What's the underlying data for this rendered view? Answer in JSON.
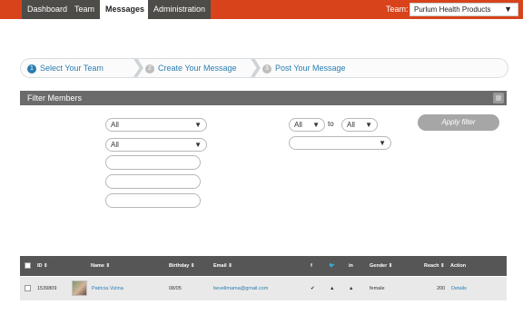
{
  "nav": {
    "tabs": [
      "Dashboard",
      "Team",
      "Messages",
      "Administration"
    ],
    "active_tab": "Messages",
    "team_label": "Team:",
    "team_value": "Purlum Health Products"
  },
  "steps": [
    {
      "num": "1",
      "label": "Select Your Team"
    },
    {
      "num": "2",
      "label": "Create Your Message"
    },
    {
      "num": "3",
      "label": "Post Your Message"
    }
  ],
  "filter": {
    "title": "Filter Members",
    "select1": "All",
    "select2": "All",
    "range_from": "All",
    "range_to_label": "to",
    "range_to": "All",
    "select3": "",
    "apply_label": "Apply filter"
  },
  "table": {
    "headers": {
      "id": "ID ⇕",
      "name": "Name ⇕",
      "birthday": "Birthday ⇕",
      "email": "Email ⇕",
      "facebook": "f",
      "twitter": "🐦",
      "linkedin": "in",
      "gender": "Gender ⇕",
      "reach": "Reach ⇕",
      "action": "Action"
    },
    "rows": [
      {
        "id": "1539809",
        "name": "Patricia Vizina",
        "birthday": "08/05",
        "email": "bevellmama@gmail.com",
        "facebook": "✔",
        "twitter": "▲",
        "linkedin": "▲",
        "gender": "female",
        "reach": "200",
        "action": "Details"
      }
    ]
  },
  "colors": {
    "topbar": "#d8431b",
    "nav_tab": "#4d4c49",
    "link": "#2a7db2",
    "filter_header": "#6b6b6b",
    "table_header": "#565656"
  }
}
